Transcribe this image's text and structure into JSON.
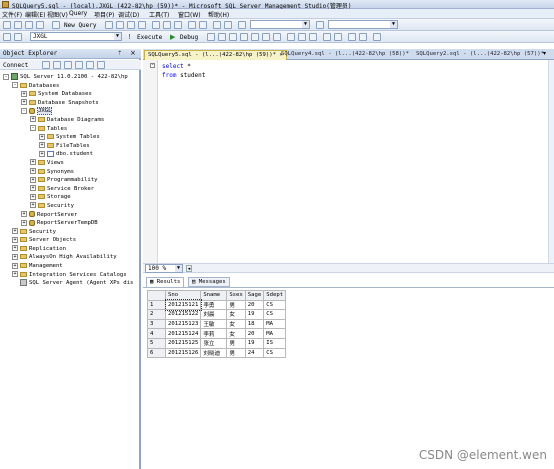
{
  "window": {
    "title": "SQLQuery5.sql - (local).JXGL (422-82\\hp (59))* - Microsoft SQL Server Management Studio(管理员)"
  },
  "menu": [
    "文件(F)",
    "编辑(E)",
    "视图(V)",
    "Query",
    "项目(P)",
    "调试(D)",
    "工具(T)",
    "窗口(W)",
    "帮助(H)"
  ],
  "toolbar1": {
    "new_query_label": "New Query"
  },
  "toolbar2": {
    "database_selected": "JXGL",
    "execute_label": "Execute",
    "debug_label": "Debug"
  },
  "object_explorer": {
    "title": "Object Explorer",
    "connect_label": "Connect",
    "tree": [
      {
        "indent": 0,
        "exp": "-",
        "icon": "srv",
        "label": "SQL Server 11.0.2100 - 422-82\\hp"
      },
      {
        "indent": 1,
        "exp": "-",
        "icon": "fold",
        "label": "Databases"
      },
      {
        "indent": 2,
        "exp": "+",
        "icon": "fold",
        "label": "System Databases"
      },
      {
        "indent": 2,
        "exp": "+",
        "icon": "fold",
        "label": "Database Snapshots"
      },
      {
        "indent": 2,
        "exp": "-",
        "icon": "db",
        "label": "JXGL"
      },
      {
        "indent": 3,
        "exp": "+",
        "icon": "fold",
        "label": "Database Diagrams"
      },
      {
        "indent": 3,
        "exp": "-",
        "icon": "fold",
        "label": "Tables"
      },
      {
        "indent": 4,
        "exp": "+",
        "icon": "fold",
        "label": "System Tables"
      },
      {
        "indent": 4,
        "exp": "+",
        "icon": "fold",
        "label": "FileTables"
      },
      {
        "indent": 4,
        "exp": "+",
        "icon": "tbl",
        "label": "dbo.student"
      },
      {
        "indent": 3,
        "exp": "+",
        "icon": "fold",
        "label": "Views"
      },
      {
        "indent": 3,
        "exp": "+",
        "icon": "fold",
        "label": "Synonyms"
      },
      {
        "indent": 3,
        "exp": "+",
        "icon": "fold",
        "label": "Programmability"
      },
      {
        "indent": 3,
        "exp": "+",
        "icon": "fold",
        "label": "Service Broker"
      },
      {
        "indent": 3,
        "exp": "+",
        "icon": "fold",
        "label": "Storage"
      },
      {
        "indent": 3,
        "exp": "+",
        "icon": "fold",
        "label": "Security"
      },
      {
        "indent": 2,
        "exp": "+",
        "icon": "db",
        "label": "ReportServer"
      },
      {
        "indent": 2,
        "exp": "+",
        "icon": "db",
        "label": "ReportServerTempDB"
      },
      {
        "indent": 1,
        "exp": "+",
        "icon": "fold",
        "label": "Security"
      },
      {
        "indent": 1,
        "exp": "+",
        "icon": "fold",
        "label": "Server Objects"
      },
      {
        "indent": 1,
        "exp": "+",
        "icon": "fold",
        "label": "Replication"
      },
      {
        "indent": 1,
        "exp": "+",
        "icon": "fold",
        "label": "AlwaysOn High Availability"
      },
      {
        "indent": 1,
        "exp": "+",
        "icon": "fold",
        "label": "Management"
      },
      {
        "indent": 1,
        "exp": "+",
        "icon": "fold",
        "label": "Integration Services Catalogs"
      },
      {
        "indent": 1,
        "exp": "",
        "icon": "agent",
        "label": "SQL Server Agent (Agent XPs dis"
      }
    ]
  },
  "doc_tabs": [
    {
      "label": "SQLQuery5.sql - (l...(422-82\\hp (59))*",
      "active": true
    },
    {
      "label": "SQLQuery4.sql - (l...(422-82\\hp (58))*",
      "active": false
    },
    {
      "label": "SQLQuery2.sql - (l...(422-82\\hp (57))*",
      "active": false
    }
  ],
  "editor": {
    "lines": [
      {
        "kw": "select",
        "rest": " *"
      },
      {
        "kw": "from",
        "rest": " student"
      }
    ]
  },
  "zoom": "100 %",
  "results_tabs": [
    "Results",
    "Messages"
  ],
  "results": {
    "columns": [
      "Sno",
      "Sname",
      "Ssex",
      "Sage",
      "Sdept"
    ],
    "rows": [
      [
        "201215121",
        "李勇",
        "男",
        "20",
        "CS"
      ],
      [
        "201215122",
        "刘晨",
        "女",
        "19",
        "CS"
      ],
      [
        "201215123",
        "王敏",
        "女",
        "18",
        "MA"
      ],
      [
        "201215124",
        "李莉",
        "女",
        "20",
        "MA"
      ],
      [
        "201215125",
        "张立",
        "男",
        "19",
        "IS"
      ],
      [
        "201215126",
        "刘晓迪",
        "男",
        "24",
        "CS"
      ]
    ]
  },
  "watermark": "CSDN @element.wen"
}
